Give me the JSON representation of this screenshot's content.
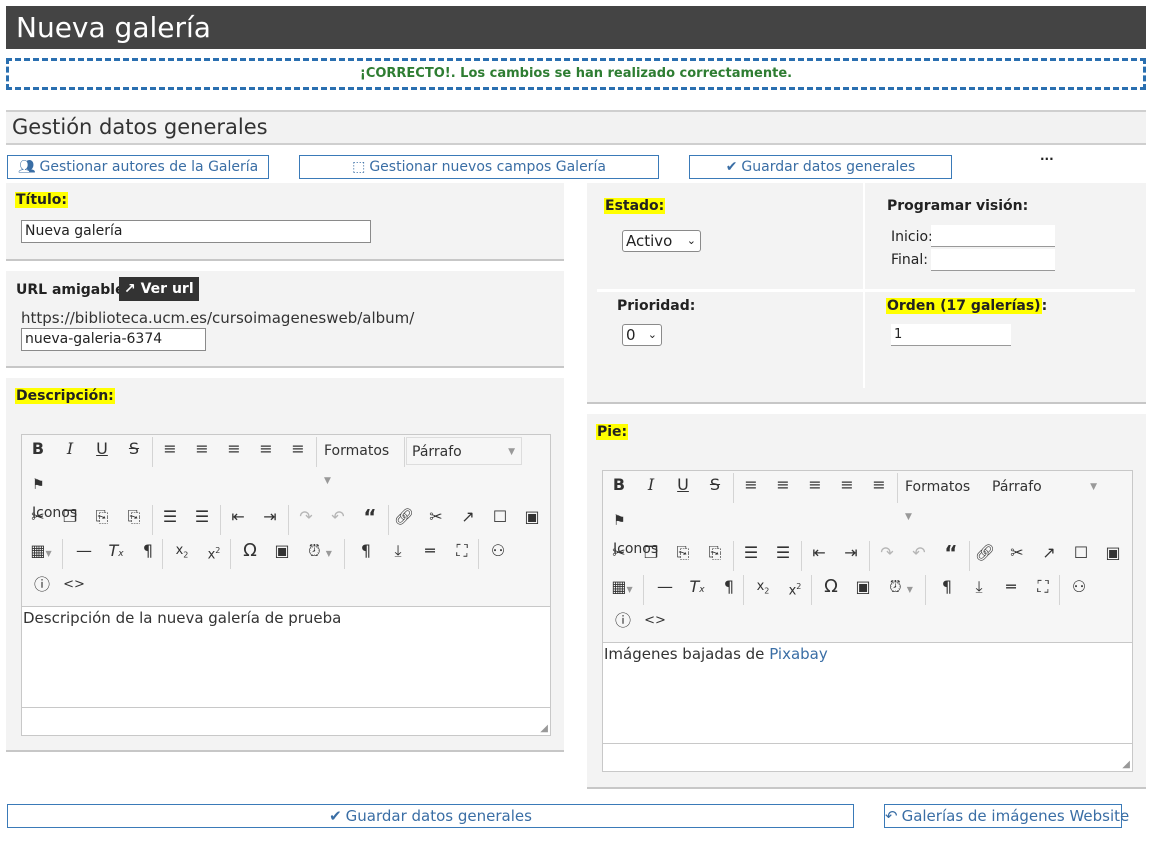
{
  "header": {
    "title": "Nueva galería"
  },
  "banner": {
    "text": "¡CORRECTO!. Los cambios se han realizado correctamente."
  },
  "section": {
    "title": "Gestión datos generales"
  },
  "actions": {
    "authors": "Gestionar autores de la Galería",
    "fields": "Gestionar nuevos campos Galería",
    "save": "Guardar datos generales",
    "more": "···"
  },
  "form": {
    "title_label": "Título:",
    "title_value": "Nueva galería",
    "url_label": "URL amigable:",
    "url_button": "Ver url",
    "url_base": "https://biblioteca.ucm.es/cursoimagenesweb/album/",
    "url_slug": "nueva-galeria-6374",
    "description_label": "Descripción:",
    "estado_label": "Estado:",
    "estado_value": "Activo",
    "programar_label": "Programar visión:",
    "inicio_label": "Inicio:",
    "final_label": "Final:",
    "prioridad_label": "Prioridad:",
    "prioridad_value": "0",
    "orden_label": "Orden (17 galerías)",
    "orden_suffix": ":",
    "orden_value": "1",
    "pie_label": "Pie:"
  },
  "editor": {
    "formats_label": "Formatos",
    "paragraph_label": "Párrafo",
    "icons_label": "Iconos"
  },
  "description_editor": {
    "content": "Descripción de la nueva galería de prueba"
  },
  "pie_editor": {
    "content_prefix": "Imágenes bajadas de ",
    "content_link": "Pixabay"
  },
  "footer": {
    "save": "Guardar datos generales",
    "back": "Galerías de imágenes Website"
  },
  "colors": {
    "header_bg": "#444444",
    "banner_border": "#2a6fb0",
    "banner_text": "#2e7d32",
    "accent": "#3a6ea5",
    "highlight": "#ffff00"
  }
}
